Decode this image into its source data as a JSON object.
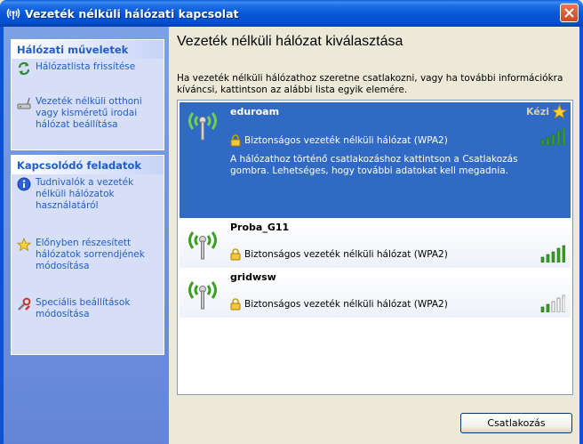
{
  "window": {
    "title": "Vezeték nélküli hálózati kapcsolat",
    "close_label": "✕"
  },
  "sidebar": {
    "network_tasks": {
      "header": "Hálózati műveletek",
      "items": [
        {
          "label": "Hálózatlista frissítése",
          "icon": "refresh-icon"
        },
        {
          "label": "Vezeték nélküli otthoni vagy kisméretű irodai hálózat beállítása",
          "icon": "wireless-setup-icon"
        }
      ]
    },
    "related_tasks": {
      "header": "Kapcsolódó feladatok",
      "items": [
        {
          "label": "Tudnivalók a vezeték nélküli hálózatok használatáról",
          "icon": "info-icon"
        },
        {
          "label": "Előnyben részesített hálózatok sorrendjének módosítása",
          "icon": "star-icon"
        },
        {
          "label": "Speciális beállítások módosítása",
          "icon": "settings-icon"
        }
      ]
    }
  },
  "main": {
    "title": "Vezeték nélküli hálózat kiválasztása",
    "description": "Ha vezeték nélküli hálózathoz szeretne csatlakozni, vagy ha további információkra kíváncsi, kattintson az alábbi lista egyik elemére.",
    "connect_label": "Csatlakozás"
  },
  "networks": [
    {
      "name": "eduroam",
      "security": "Biztonságos vezeték nélküli hálózat (WPA2)",
      "status": "Kézi",
      "info": "A hálózathoz történő csatlakozáshoz kattintson a Csatlakozás gombra. Lehetséges, hogy további adatokat kell megadnia.",
      "signal_bars": 5,
      "selected": true
    },
    {
      "name": "Proba_G11",
      "security": "Biztonságos vezeték nélküli hálózat (WPA2)",
      "signal_bars": 5,
      "selected": false
    },
    {
      "name": "gridwsw",
      "security": "Biztonságos vezeték nélküli hálózat (WPA2)",
      "signal_bars": 2,
      "selected": false
    }
  ],
  "colors": {
    "selection": "#316ac5",
    "link": "#215dc6",
    "signal_on": "#3aa021",
    "signal_off": "#ffffff"
  }
}
